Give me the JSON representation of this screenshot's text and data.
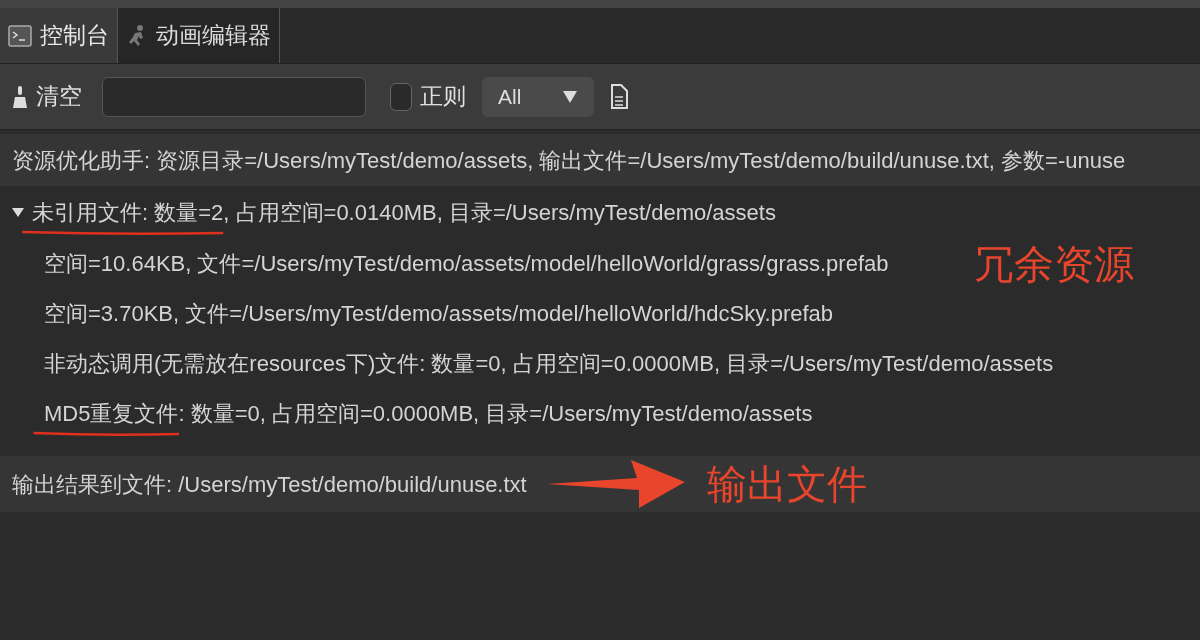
{
  "tabs": [
    {
      "label": "控制台",
      "kind": "console",
      "selected": true
    },
    {
      "label": "动画编辑器",
      "kind": "animation",
      "selected": false
    }
  ],
  "toolbar": {
    "clear_label": "清空",
    "regex": {
      "label": "正则",
      "checked": false
    },
    "level_select": {
      "value": "All"
    }
  },
  "log": [
    {
      "kind": "line",
      "text": "资源优化助手: 资源目录=/Users/myTest/demo/assets, 输出文件=/Users/myTest/demo/build/unuse.txt, 参数=-unuse"
    },
    {
      "kind": "group",
      "expanded": true,
      "marked": "未引用文件: 数量=2",
      "text": ", 占用空间=0.0140MB, 目录=/Users/myTest/demo/assets",
      "note": "冗余资源",
      "children": [
        {
          "text": "空间=10.64KB, 文件=/Users/myTest/demo/assets/model/helloWorld/grass/grass.prefab"
        },
        {
          "text": "空间=3.70KB, 文件=/Users/myTest/demo/assets/model/helloWorld/hdcSky.prefab"
        }
      ]
    },
    {
      "kind": "sub",
      "text": "非动态调用(无需放在resources下)文件: 数量=0, 占用空间=0.0000MB, 目录=/Users/myTest/demo/assets"
    },
    {
      "kind": "sub",
      "marked": "MD5重复文件",
      "text": ": 数量=0, 占用空间=0.0000MB, 目录=/Users/myTest/demo/assets"
    },
    {
      "kind": "output",
      "text": "输出结果到文件: /Users/myTest/demo/build/unuse.txt",
      "note": "输出文件"
    }
  ]
}
